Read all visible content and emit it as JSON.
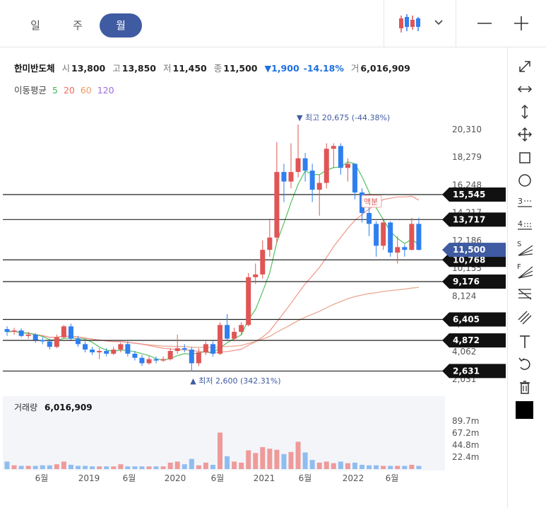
{
  "tabs": [
    {
      "label": "일"
    },
    {
      "label": "주"
    },
    {
      "label": "월"
    }
  ],
  "stock": {
    "name": "한미반도체",
    "open_label": "시",
    "open": "13,800",
    "high_label": "고",
    "high": "13,850",
    "low_label": "저",
    "low": "11,450",
    "close_label": "종",
    "close": "11,500",
    "change": "▼1,900",
    "change_pct": "-14.18%",
    "vol_label": "거",
    "volume": "6,016,909"
  },
  "ma": {
    "title": "이동평균",
    "p5": "5",
    "p20": "20",
    "p60": "60",
    "p120": "120"
  },
  "colors": {
    "up": "#e05555",
    "down": "#2f7ff0",
    "ma5": "#3fb950",
    "ma20": "#f08a7e",
    "ma60": "#f6b27e",
    "ma120": "#b37fe8",
    "price_tag": "#3f5ba1"
  },
  "chart_data": {
    "type": "candlestick",
    "y_ticks": [
      "20,310",
      "18,279",
      "16,248",
      "14,217",
      "12,186",
      "10,155",
      "8,124",
      "6,093",
      "4,062",
      "2,031"
    ],
    "x_ticks": [
      "6월",
      "2019",
      "6월",
      "2020",
      "6월",
      "2021",
      "6월",
      "2022",
      "6월"
    ],
    "hlines": [
      "15,545",
      "13,717",
      "10,768",
      "9,176",
      "6,405",
      "4,872",
      "2,631"
    ],
    "current": "11,500",
    "max_label": "▼ 최고 20,675 (-44.38%)",
    "min_label": "▲ 최저 2,600 (342.31%)",
    "overlay_label": "액분",
    "candles": [
      {
        "o": 5700,
        "c": 5500,
        "h": 5900,
        "l": 5200
      },
      {
        "o": 5500,
        "c": 5600,
        "h": 5800,
        "l": 5300
      },
      {
        "o": 5600,
        "c": 5200,
        "h": 5750,
        "l": 5100
      },
      {
        "o": 5200,
        "c": 5300,
        "h": 5500,
        "l": 5000
      },
      {
        "o": 5300,
        "c": 4900,
        "h": 5400,
        "l": 4700
      },
      {
        "o": 4900,
        "c": 4800,
        "h": 5100,
        "l": 4600
      },
      {
        "o": 4800,
        "c": 4400,
        "h": 5000,
        "l": 4200
      },
      {
        "o": 4400,
        "c": 5100,
        "h": 5300,
        "l": 4300
      },
      {
        "o": 5100,
        "c": 5900,
        "h": 6000,
        "l": 5000
      },
      {
        "o": 5900,
        "c": 5000,
        "h": 6100,
        "l": 4900
      },
      {
        "o": 5000,
        "c": 4600,
        "h": 5200,
        "l": 4400
      },
      {
        "o": 4600,
        "c": 4200,
        "h": 4800,
        "l": 4000
      },
      {
        "o": 4200,
        "c": 4000,
        "h": 4400,
        "l": 3800
      },
      {
        "o": 4000,
        "c": 4100,
        "h": 4300,
        "l": 3500
      },
      {
        "o": 4100,
        "c": 3900,
        "h": 4300,
        "l": 3700
      },
      {
        "o": 3900,
        "c": 4200,
        "h": 4400,
        "l": 3800
      },
      {
        "o": 4200,
        "c": 4600,
        "h": 4700,
        "l": 4000
      },
      {
        "o": 4600,
        "c": 3900,
        "h": 4800,
        "l": 3700
      },
      {
        "o": 3900,
        "c": 3600,
        "h": 4100,
        "l": 3400
      },
      {
        "o": 3600,
        "c": 3200,
        "h": 3800,
        "l": 3000
      },
      {
        "o": 3200,
        "c": 3500,
        "h": 3700,
        "l": 3100
      },
      {
        "o": 3500,
        "c": 3400,
        "h": 3700,
        "l": 3200
      },
      {
        "o": 3400,
        "c": 3500,
        "h": 3700,
        "l": 3300
      },
      {
        "o": 3500,
        "c": 4100,
        "h": 4300,
        "l": 3400
      },
      {
        "o": 4100,
        "c": 4300,
        "h": 5300,
        "l": 3900
      },
      {
        "o": 4300,
        "c": 4200,
        "h": 4600,
        "l": 4000
      },
      {
        "o": 4200,
        "c": 3200,
        "h": 4400,
        "l": 2600
      },
      {
        "o": 3200,
        "c": 4000,
        "h": 4300,
        "l": 3000
      },
      {
        "o": 4000,
        "c": 4600,
        "h": 4800,
        "l": 3800
      },
      {
        "o": 4600,
        "c": 3900,
        "h": 4800,
        "l": 3700
      },
      {
        "o": 3900,
        "c": 6000,
        "h": 6200,
        "l": 3800
      },
      {
        "o": 6000,
        "c": 5000,
        "h": 6800,
        "l": 4900
      },
      {
        "o": 5000,
        "c": 5500,
        "h": 5800,
        "l": 4800
      },
      {
        "o": 5500,
        "c": 6000,
        "h": 6200,
        "l": 5300
      },
      {
        "o": 6000,
        "c": 9500,
        "h": 9800,
        "l": 5900
      },
      {
        "o": 9500,
        "c": 9700,
        "h": 10500,
        "l": 9000
      },
      {
        "o": 9700,
        "c": 11500,
        "h": 12200,
        "l": 9400
      },
      {
        "o": 11500,
        "c": 12400,
        "h": 13800,
        "l": 11000
      },
      {
        "o": 12400,
        "c": 17200,
        "h": 19400,
        "l": 12000
      },
      {
        "o": 17200,
        "c": 16500,
        "h": 17800,
        "l": 15000
      },
      {
        "o": 16500,
        "c": 17200,
        "h": 19300,
        "l": 16000
      },
      {
        "o": 17200,
        "c": 18200,
        "h": 20675,
        "l": 16800
      },
      {
        "o": 18200,
        "c": 17300,
        "h": 18600,
        "l": 16500
      },
      {
        "o": 17300,
        "c": 15900,
        "h": 17800,
        "l": 15000
      },
      {
        "o": 15900,
        "c": 16400,
        "h": 17000,
        "l": 14000
      },
      {
        "o": 16400,
        "c": 18900,
        "h": 19300,
        "l": 16000
      },
      {
        "o": 18900,
        "c": 19100,
        "h": 19300,
        "l": 17500
      },
      {
        "o": 19100,
        "c": 17500,
        "h": 19300,
        "l": 17000
      },
      {
        "o": 17500,
        "c": 17800,
        "h": 18200,
        "l": 16500
      },
      {
        "o": 17800,
        "c": 15700,
        "h": 17800,
        "l": 15200
      },
      {
        "o": 15700,
        "c": 14200,
        "h": 16000,
        "l": 13500
      },
      {
        "o": 14200,
        "c": 13400,
        "h": 14600,
        "l": 12500
      },
      {
        "o": 13400,
        "c": 11800,
        "h": 13600,
        "l": 11000
      },
      {
        "o": 11800,
        "c": 13500,
        "h": 13800,
        "l": 11500
      },
      {
        "o": 13500,
        "c": 11300,
        "h": 13600,
        "l": 11000
      },
      {
        "o": 11300,
        "c": 11700,
        "h": 12500,
        "l": 10500
      },
      {
        "o": 11700,
        "c": 11500,
        "h": 11900,
        "l": 11000
      },
      {
        "o": 11500,
        "c": 13400,
        "h": 13850,
        "l": 11450
      },
      {
        "o": 13400,
        "c": 11500,
        "h": 13850,
        "l": 11450
      }
    ],
    "volume_title": "거래량",
    "volume_value": "6,016,909",
    "volume_ticks": [
      "89.7m",
      "67.2m",
      "44.8m",
      "22.4m"
    ],
    "volumes_m": [
      14,
      7,
      6,
      6,
      6,
      7,
      7,
      9,
      14,
      8,
      6,
      6,
      5,
      5,
      5,
      5,
      9,
      5,
      5,
      5,
      5,
      5,
      5,
      12,
      14,
      9,
      19,
      7,
      12,
      8,
      68,
      24,
      14,
      12,
      35,
      30,
      41,
      38,
      36,
      28,
      32,
      51,
      31,
      17,
      12,
      14,
      11,
      14,
      11,
      12,
      8,
      7,
      7,
      6,
      6,
      6,
      6,
      8,
      6
    ]
  }
}
